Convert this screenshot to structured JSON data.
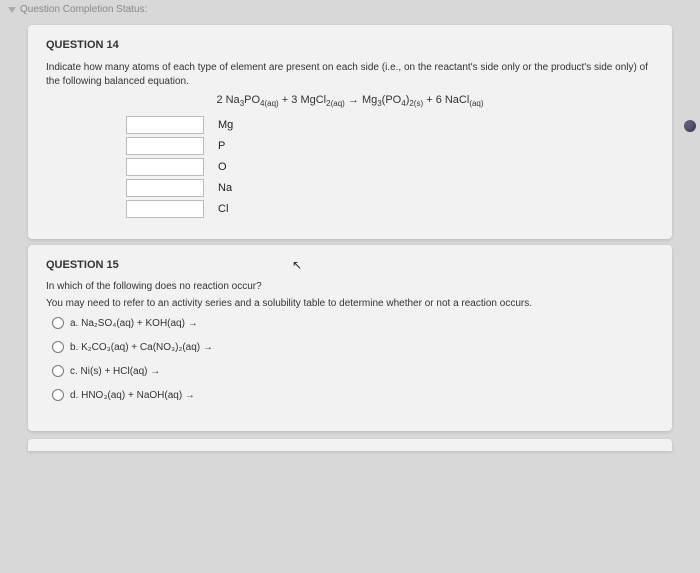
{
  "status": {
    "label": "Question Completion Status:"
  },
  "q14": {
    "title": "QUESTION 14",
    "prompt": "Indicate how many atoms of each type of element are present on each side (i.e., on the reactant's side only or the product's side only) of the following balanced equation.",
    "equation_parts": {
      "lhs1": "2 Na",
      "lhs1s": "3",
      "lhs1b": "PO",
      "lhs1bs": "4(aq)",
      "plus1": " + ",
      "lhs2": "3 MgCl",
      "lhs2s": "2(aq)",
      "arrow": " → ",
      "rhs1": "Mg",
      "rhs1s": "3",
      "rhs1b": "(PO",
      "rhs1bs": "4",
      "rhs1c": ")",
      "rhs1cs": "2(s)",
      "plus2": " + ",
      "rhs2": "6 NaCl",
      "rhs2s": "(aq)"
    },
    "atoms": [
      "Mg",
      "P",
      "O",
      "Na",
      "Cl"
    ]
  },
  "q15": {
    "title": "QUESTION 15",
    "line1": "In which of the following does no reaction occur?",
    "line2": "You may need to refer to an activity series and a solubility table to determine whether or not a reaction occurs.",
    "choices": {
      "a": "a. Na₂SO₄(aq) + KOH(aq) →",
      "b": "b. K₂CO₃(aq) + Ca(NO₃)₂(aq) →",
      "c": "c. Ni(s) + HCl(aq) →",
      "d": "d. HNO₃(aq) + NaOH(aq) →"
    }
  },
  "bottom": {
    "title_fragment": ""
  }
}
